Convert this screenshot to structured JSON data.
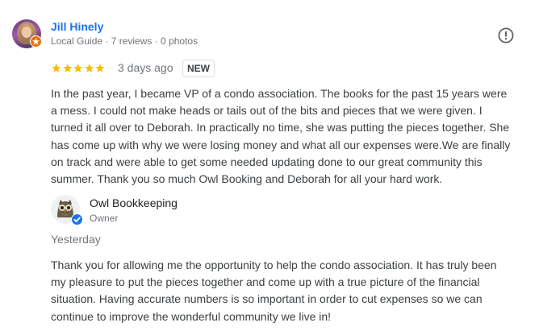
{
  "review": {
    "reviewer_name": "Jill Hinely",
    "reviewer_meta": "Local Guide · 7 reviews · 0 photos",
    "avatar_icon": "reviewer-avatar",
    "badge_icon": "local-guide-star-icon",
    "badge_color": "#e8710a",
    "report_icon": "report-icon",
    "rating": 5,
    "rating_max": 5,
    "star_color": "#fbbc04",
    "date": "3 days ago",
    "new_badge": "NEW",
    "text_lines": [
      "In the past year, I became VP of a condo association. The books for the past 15 years were",
      "a mess. I could not make heads or tails out of the bits and pieces that we were given. I",
      "turned it all over to Deborah. In practically no time, she was putting the pieces together. She",
      "has come up with why we were losing money and what all our expenses were.We are finally",
      "on track and were able to get some needed updating done to our great community this",
      "summer. Thank you so much Owl Booking and Deborah for all your hard work."
    ]
  },
  "reply": {
    "owner_name": "Owl Bookkeeping",
    "owner_role": "Owner",
    "avatar_icon": "owl-logo",
    "verified_icon": "verified-check-icon",
    "verified_color": "#1a73e8",
    "date": "Yesterday",
    "text_lines": [
      "Thank you for allowing me the opportunity to help the condo association. It has truly been",
      "my pleasure to put the pieces together and come up with a true picture of the financial",
      "situation. Having accurate numbers is so important in order to cut expenses so we can",
      "continue to improve the wonderful community we live in!"
    ]
  },
  "colors": {
    "link_blue": "#1a73e8",
    "text": "#3c4043",
    "meta": "#70757a"
  }
}
